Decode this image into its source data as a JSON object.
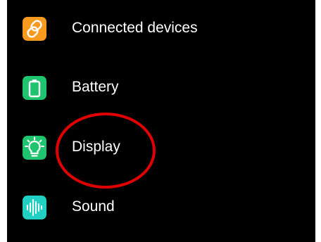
{
  "settings": {
    "items": [
      {
        "label": "Connected devices",
        "icon": "link-icon",
        "icon_color": "#F79A1E"
      },
      {
        "label": "Battery",
        "icon": "battery-icon",
        "icon_color": "#1FC46E"
      },
      {
        "label": "Display",
        "icon": "lightbulb-icon",
        "icon_color": "#1FC46E"
      },
      {
        "label": "Sound",
        "icon": "sound-wave-icon",
        "icon_color": "#22CFC3"
      }
    ]
  },
  "annotation": {
    "shape": "ellipse",
    "color": "#E00000",
    "highlights": "Display"
  }
}
